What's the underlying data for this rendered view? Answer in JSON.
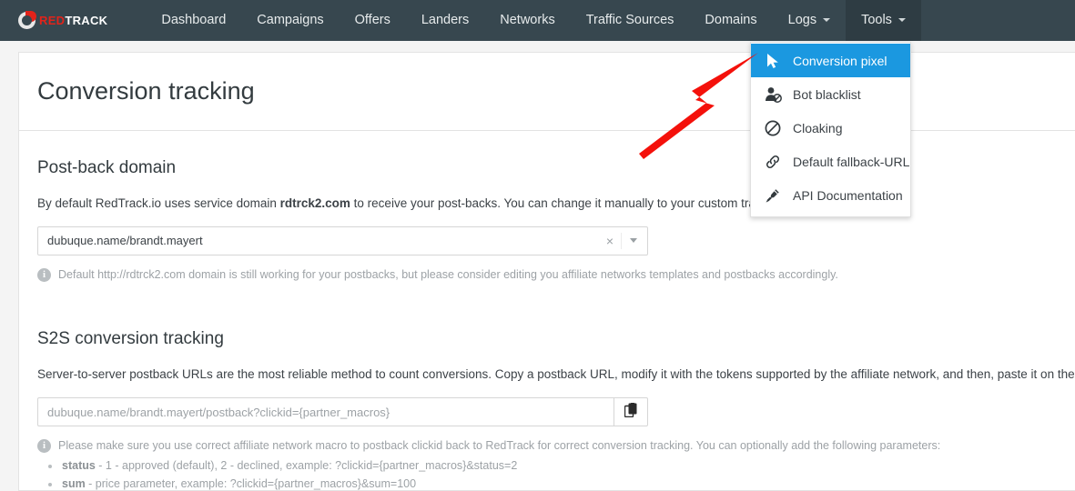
{
  "brand": {
    "red": "RED",
    "white": "TRACK",
    "accent": "#e2231a"
  },
  "nav": {
    "items": [
      {
        "label": "Dashboard",
        "caret": false,
        "active": false
      },
      {
        "label": "Campaigns",
        "caret": false,
        "active": false
      },
      {
        "label": "Offers",
        "caret": false,
        "active": false
      },
      {
        "label": "Landers",
        "caret": false,
        "active": false
      },
      {
        "label": "Networks",
        "caret": false,
        "active": false
      },
      {
        "label": "Traffic Sources",
        "caret": false,
        "active": false
      },
      {
        "label": "Domains",
        "caret": false,
        "active": false
      },
      {
        "label": "Logs",
        "caret": true,
        "active": false
      },
      {
        "label": "Tools",
        "caret": true,
        "active": true
      }
    ],
    "bar_color": "#37474f",
    "active_color": "#2e3c43"
  },
  "dropdown": {
    "open_for": "Tools",
    "highlight_color": "#1b98e0",
    "items": [
      {
        "label": "Conversion pixel",
        "icon": "cursor-arrow-icon",
        "selected": true
      },
      {
        "label": "Bot blacklist",
        "icon": "user-blocked-icon",
        "selected": false
      },
      {
        "label": "Cloaking",
        "icon": "no-entry-icon",
        "selected": false
      },
      {
        "label": "Default fallback-URL",
        "icon": "link-chain-icon",
        "selected": false
      },
      {
        "label": "API Documentation",
        "icon": "plug-icon",
        "selected": false
      }
    ]
  },
  "page": {
    "title": "Conversion tracking"
  },
  "postback_section": {
    "heading": "Post-back domain",
    "description_prefix": "By default RedTrack.io uses service domain ",
    "description_bold": "rdtrck2.com",
    "description_suffix": " to receive your post-backs. You can change it manually to your custom tracking domain below.",
    "domain_value": "dubuque.name/brandt.mayert",
    "clear_label": "×",
    "hint": "Default http://rdtrck2.com domain is still working for your postbacks, but please consider editing you affiliate networks templates and postbacks accordingly."
  },
  "s2s_section": {
    "heading": "S2S conversion tracking",
    "description": "Server-to-server postback URLs are the most reliable method to count conversions. Copy a postback URL, modify it with the tokens supported by the affiliate network, and then, paste it on the affiliate",
    "postback_url": "dubuque.name/brandt.mayert/postback?clickid={partner_macros}",
    "hint": "Please make sure you use correct affiliate network macro to postback clickid back to RedTrack for correct conversion tracking. You can optionally add the following parameters:",
    "params": [
      {
        "name": "status",
        "text": " - 1 - approved (default), 2 - declined, example: ?clickid={partner_macros}&status=2"
      },
      {
        "name": "sum",
        "text": " - price parameter, example: ?clickid={partner_macros}&sum=100"
      }
    ]
  },
  "annotation": {
    "type": "red-arrow",
    "color": "#f4110b",
    "points_to": "Conversion pixel"
  }
}
